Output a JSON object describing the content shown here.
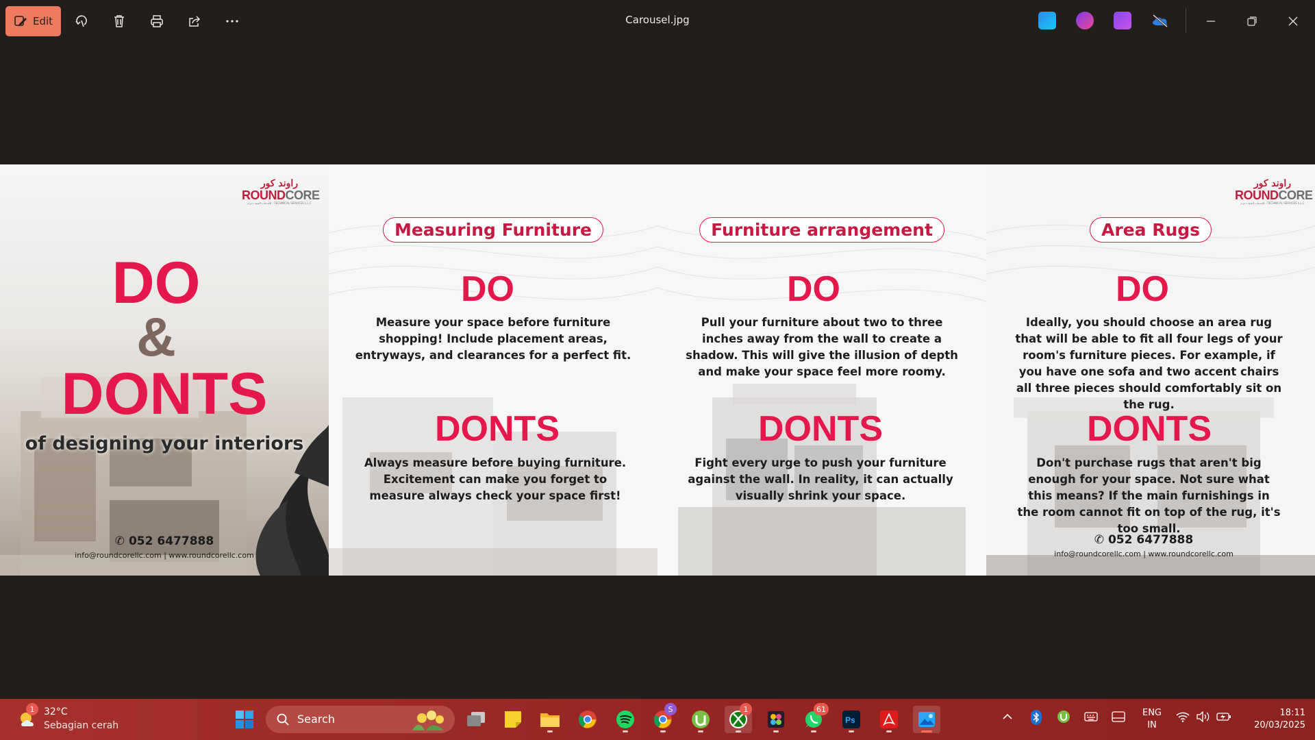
{
  "titlebar": {
    "edit_label": "Edit",
    "file_name": "Carousel.jpg"
  },
  "carousel": {
    "logo": {
      "arabic": "راوند كور",
      "brand_red": "ROUND",
      "brand_gray": "CORE",
      "tagline": "للخدمات الفنية ذ.م.م · TECHNICAL SERVICES L.L.C"
    },
    "cover": {
      "do": "DO",
      "amp": "&",
      "donts": "DONTS",
      "subtitle": "of designing your interiors",
      "phone": "052 6477888",
      "contact": "info@roundcorellc.com | www.roundcorellc.com"
    },
    "slides": [
      {
        "topic": "Measuring Furniture",
        "do_heading": "DO",
        "do_text": "Measure your space before furniture shopping! Include placement areas, entryways, and clearances for a perfect fit.",
        "donts_heading": "DONTS",
        "donts_text": "Always measure before buying furniture. Excitement can make you forget to measure always check your space first!"
      },
      {
        "topic": "Furniture arrangement",
        "do_heading": "DO",
        "do_text": "Pull your furniture about two to three inches away from the wall to create a shadow. This will give the illusion of depth and make your space feel more roomy.",
        "donts_heading": "DONTS",
        "donts_text": "Fight every urge to push your furniture against the wall. In reality, it can actually visually shrink your space."
      },
      {
        "topic": "Area Rugs",
        "do_heading": "DO",
        "do_text": "Ideally, you should choose an area rug that will be able to fit all four legs of your room's furniture pieces. For example, if you have one sofa and two accent chairs all three pieces should comfortably sit on the rug.",
        "donts_heading": "DONTS",
        "donts_text": "Don't purchase rugs that aren't big enough for your space. Not sure what this means? If the main furnishings in the room cannot fit on top of the rug, it's too small.",
        "phone": "052 6477888",
        "contact": "info@roundcorellc.com | www.roundcorellc.com"
      }
    ]
  },
  "taskbar": {
    "weather_temp": "32°C",
    "weather_cond": "Sebagian cerah",
    "weather_badge": "1",
    "search_placeholder": "Search",
    "xbox_badge": "1",
    "chrome_profile_badge": "S",
    "whatsapp_badge": "61",
    "lang_line1": "ENG",
    "lang_line2": "IN",
    "time": "18:11",
    "date": "20/03/2025"
  },
  "colors": {
    "accent_red": "#e4184a",
    "edit_button": "#ee7a60",
    "taskbar": "#9e2a28",
    "window_bg": "#231d1b"
  }
}
